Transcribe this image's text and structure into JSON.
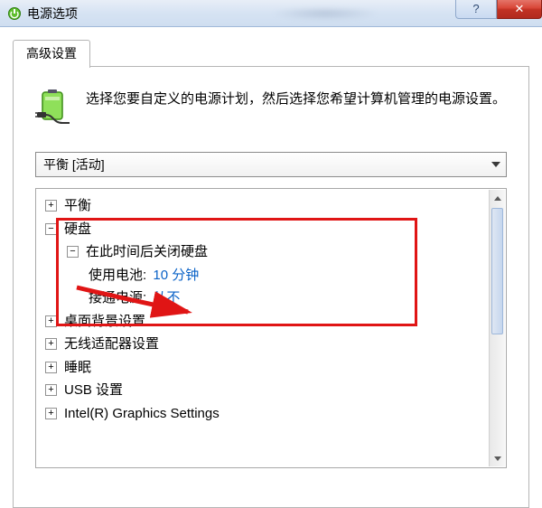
{
  "titlebar": {
    "title": "电源选项",
    "help_symbol": "?",
    "close_symbol": "✕"
  },
  "tab": {
    "label": "高级设置"
  },
  "description": "选择您要自定义的电源计划，然后选择您希望计算机管理的电源设置。",
  "combo": {
    "selected": "平衡 [活动]"
  },
  "tree": {
    "items": [
      {
        "expanded": false,
        "level": 0,
        "label": "平衡"
      },
      {
        "expanded": true,
        "level": 0,
        "label": "硬盘"
      },
      {
        "expanded": true,
        "level": 1,
        "label": "在此时间后关闭硬盘"
      },
      {
        "kv": true,
        "level": 2,
        "key": "使用电池",
        "value": "10 分钟"
      },
      {
        "kv": true,
        "level": 2,
        "key": "接通电源",
        "value": "从不"
      },
      {
        "expanded": false,
        "level": 0,
        "label": "桌面背景设置"
      },
      {
        "expanded": false,
        "level": 0,
        "label": "无线适配器设置"
      },
      {
        "expanded": false,
        "level": 0,
        "label": "睡眠"
      },
      {
        "expanded": false,
        "level": 0,
        "label": "USB 设置"
      },
      {
        "expanded": false,
        "level": 0,
        "label": "Intel(R) Graphics Settings"
      }
    ],
    "glyph_plus": "+",
    "glyph_minus": "−",
    "kv_sep": ":"
  }
}
